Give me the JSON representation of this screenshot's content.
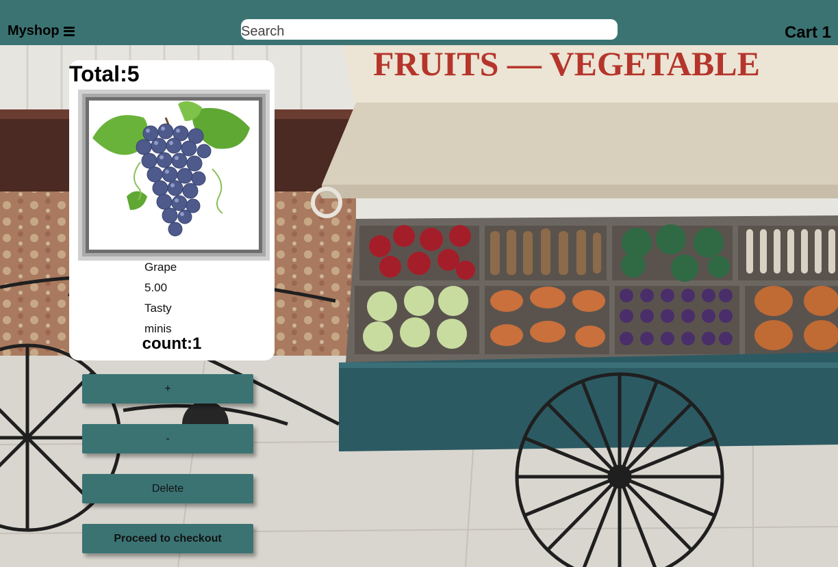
{
  "navbar": {
    "brand": "Myshop",
    "menu_icon": "bars-icon",
    "search_placeholder": "Search",
    "cart_label": "Cart 1"
  },
  "cart": {
    "total_label": "Total:5",
    "item": {
      "name": "Grape",
      "price": "5.00",
      "description": "Tasty",
      "category": "minis",
      "count_label": "count:1",
      "image": "grape-bunch-image"
    }
  },
  "actions": {
    "increment_label": "+",
    "decrement_label": "-",
    "delete_label": "Delete",
    "checkout_label": "Proceed to checkout"
  },
  "background": {
    "sign_text": "FRUITS — VEGETABLE",
    "image": "fruit-vegetable-cart-photo"
  },
  "colors": {
    "accent": "#3b7373",
    "card_bg": "#ffffff"
  }
}
